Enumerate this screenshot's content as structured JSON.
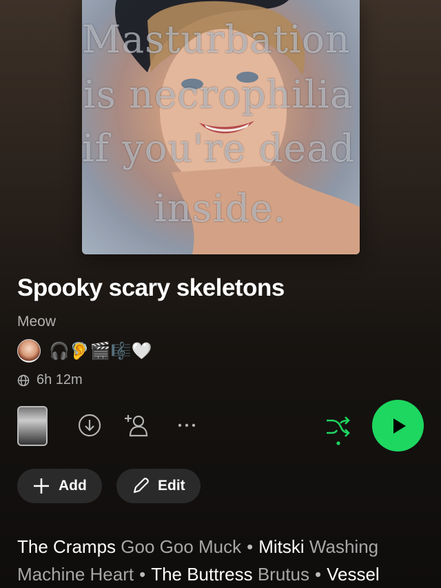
{
  "cover": {
    "text_lines": [
      "Masturbation",
      "is necrophilia",
      "if you're dead",
      "inside."
    ]
  },
  "playlist": {
    "title": "Spooky scary skeletons",
    "owner": "Meow",
    "collaborator_emojis": "🎧🦻🎬🎼🤍",
    "duration": "6h 12m"
  },
  "actions": {
    "add_label": "Add",
    "edit_label": "Edit"
  },
  "preview_tracks": [
    {
      "artist": "The Cramps",
      "title": "Goo Goo Muck"
    },
    {
      "artist": "Mitski",
      "title": "Washing Machine Heart"
    },
    {
      "artist": "The Buttress",
      "title": "Brutus"
    },
    {
      "artist": "Vessel",
      "title": ""
    }
  ],
  "colors": {
    "accent": "#1ed760",
    "muted_text": "#b3b3b3"
  }
}
